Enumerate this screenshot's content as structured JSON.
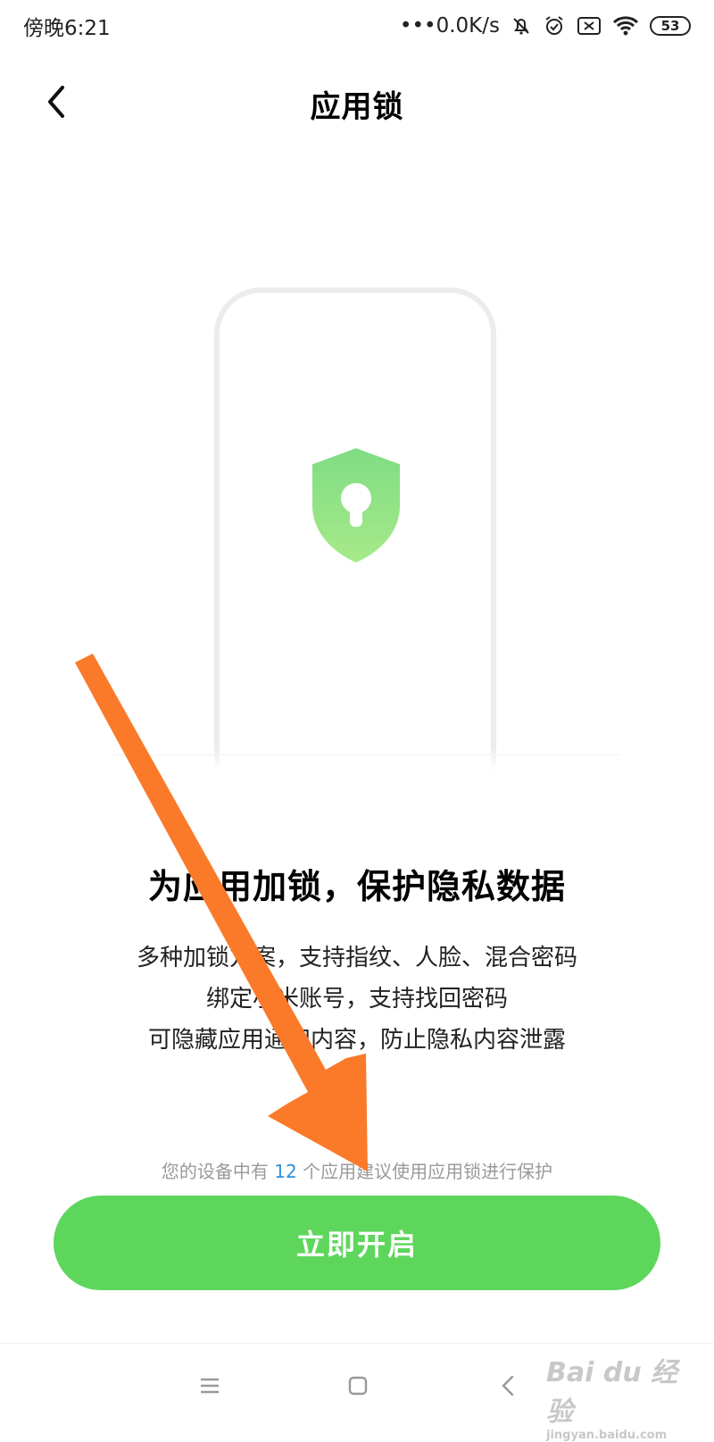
{
  "status_bar": {
    "time": "傍晚6:21",
    "network_speed": "•••0.0K/s",
    "battery_level": "53",
    "icons": [
      "mute-bell-icon",
      "alarm-icon",
      "sim-off-icon",
      "wifi-icon",
      "battery-icon"
    ]
  },
  "header": {
    "title": "应用锁",
    "back_icon": "chevron-left-icon"
  },
  "illustration": {
    "shield_icon": "shield-lock-icon",
    "shield_color_top": "#7fdc83",
    "shield_color_bottom": "#a4e98a"
  },
  "content": {
    "headline": "为应用加锁，保护隐私数据",
    "description": [
      "多种加锁方案，支持指纹、人脸、混合密码",
      "绑定小米账号，支持找回密码",
      "可隐藏应用通知内容，防止隐私内容泄露"
    ]
  },
  "hint": {
    "prefix": "您的设备中有 ",
    "count": "12",
    "suffix": " 个应用建议使用应用锁进行保护"
  },
  "primary_button": {
    "label": "立即开启",
    "color": "#5ed65c"
  },
  "nav_bar": {
    "items": [
      "menu-icon",
      "home-square-icon",
      "back-triangle-icon"
    ]
  },
  "watermark": {
    "brand": "Bai du 经验",
    "url": "jingyan.baidu.com"
  },
  "annotation": {
    "arrow_color": "#fb7a2a"
  }
}
